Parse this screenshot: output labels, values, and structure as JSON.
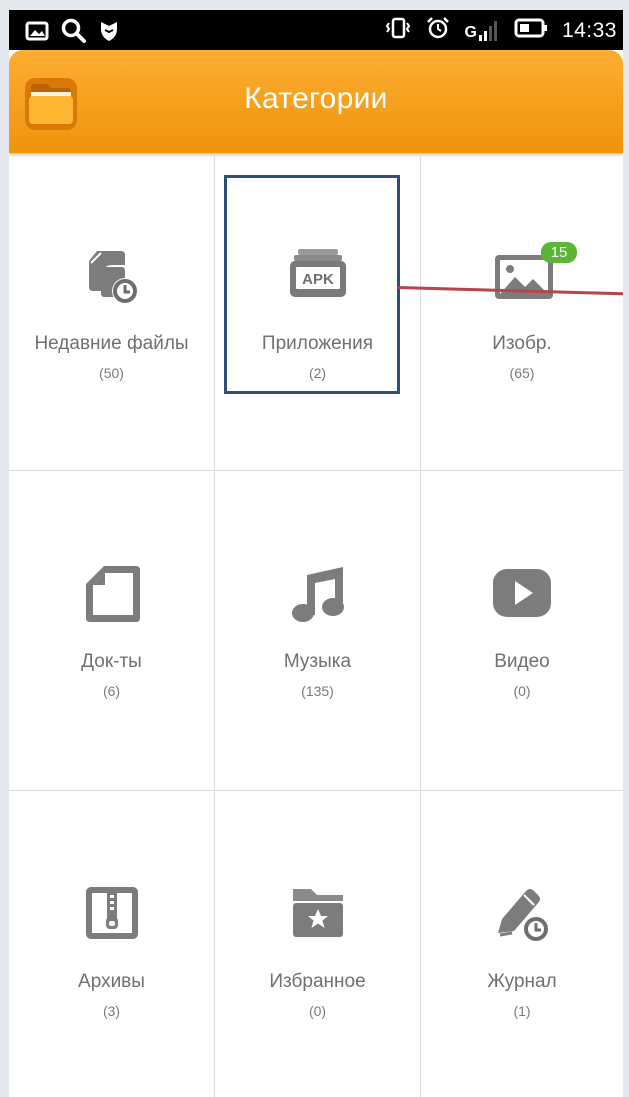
{
  "status_bar": {
    "time": "14:33",
    "left_icons": [
      "gallery-icon",
      "search-icon",
      "shield-icon"
    ],
    "right_icons": [
      "vibrate-icon",
      "alarm-icon",
      "signal-edge-icon",
      "battery-icon"
    ],
    "network_letter": "G"
  },
  "app_bar": {
    "title": "Категории",
    "logo_icon": "folder-icon"
  },
  "categories": [
    {
      "label": "Недавние файлы",
      "count": "(50)",
      "icon": "recent-files-icon"
    },
    {
      "label": "Приложения",
      "count": "(2)",
      "icon": "apk-icon"
    },
    {
      "label": "Изобр.",
      "count": "(65)",
      "icon": "image-icon",
      "badge": "15"
    },
    {
      "label": "Док-ты",
      "count": "(6)",
      "icon": "document-icon"
    },
    {
      "label": "Музыка",
      "count": "(135)",
      "icon": "music-icon"
    },
    {
      "label": "Видео",
      "count": "(0)",
      "icon": "video-icon"
    },
    {
      "label": "Архивы",
      "count": "(3)",
      "icon": "archive-icon"
    },
    {
      "label": "Избранное",
      "count": "(0)",
      "icon": "favorites-folder-icon"
    },
    {
      "label": "Журнал",
      "count": "(1)",
      "icon": "history-log-icon"
    }
  ],
  "apk_text": "APK",
  "colors": {
    "app_bar": "#f7a11f",
    "icon_gray": "#707070",
    "badge_green": "#5bb536",
    "highlight_box": "#2f4e74",
    "annotation_line": "#b5444b"
  }
}
